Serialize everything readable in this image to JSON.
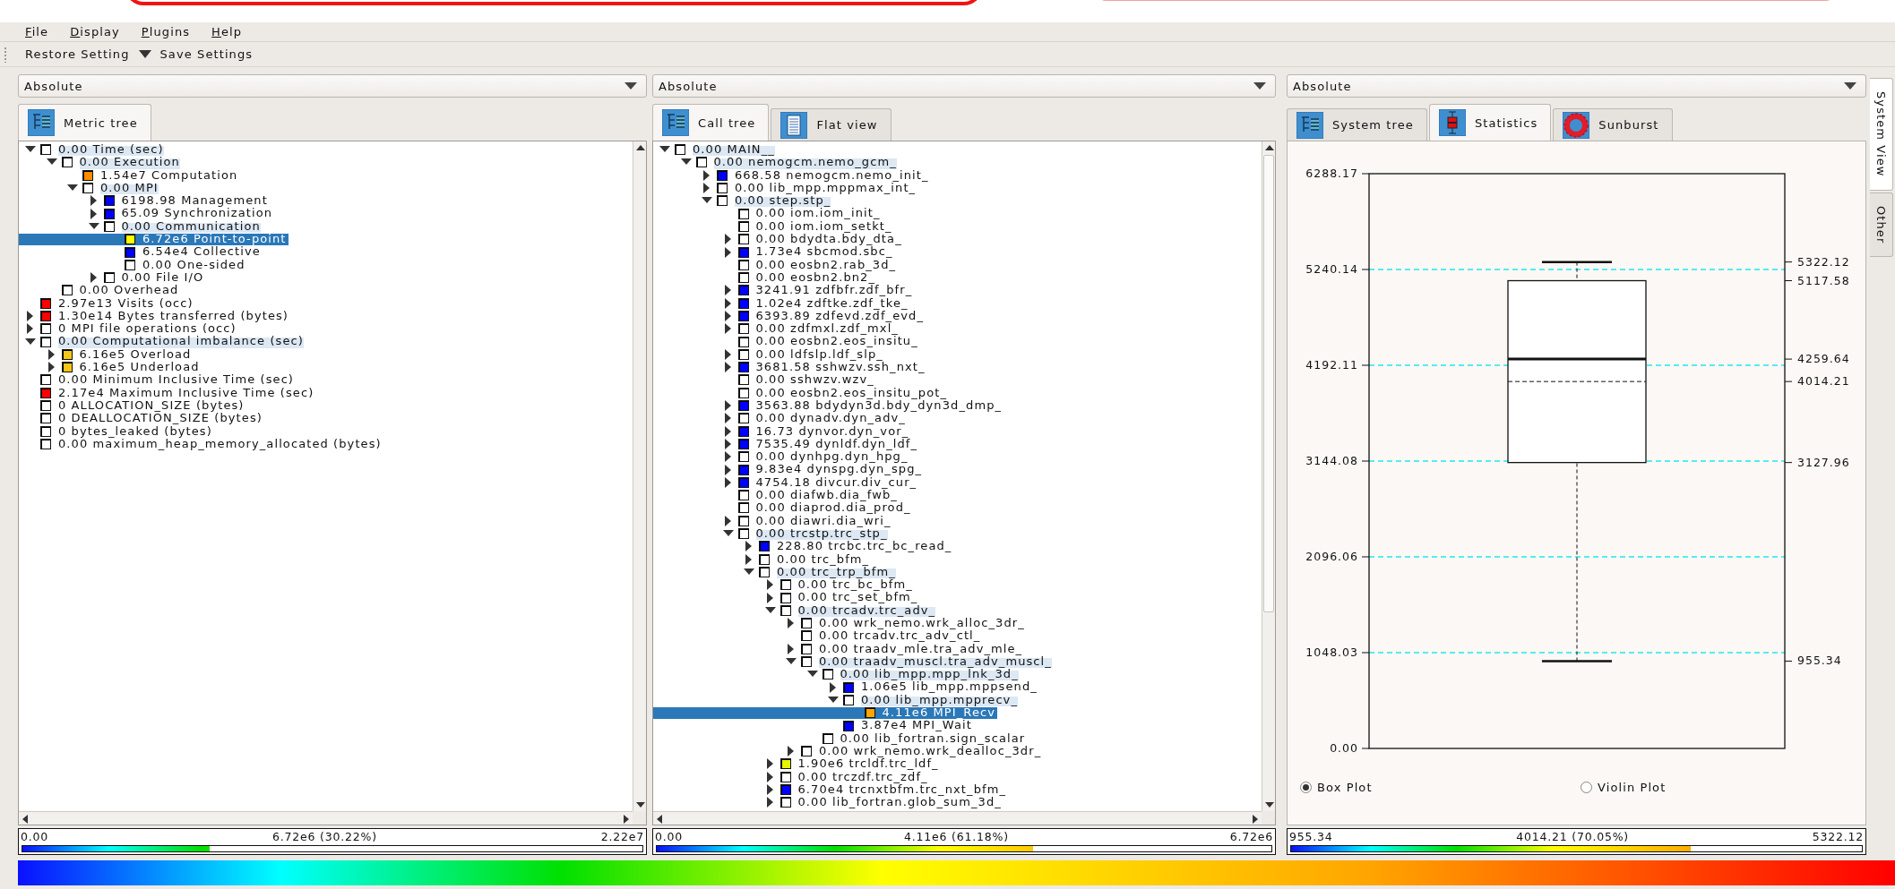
{
  "menu": [
    "File",
    "Display",
    "Plugins",
    "Help"
  ],
  "toolbar": {
    "restore": "Restore Setting",
    "save": "Save Settings"
  },
  "panels": [
    {
      "kind": "tree",
      "mode": "Absolute",
      "tabs": [
        {
          "label": "Metric tree",
          "kind": "tree",
          "selected": true
        }
      ],
      "tree": [
        {
          "text": "0.00 Time (sec)",
          "color": "#ffffff",
          "selected": false,
          "expanded": true,
          "children": [
            {
              "text": "0.00 Execution",
              "color": "#ffffff",
              "selected": false,
              "expanded": true,
              "children": [
                {
                  "text": "1.54e7 Computation",
                  "color": "#ff8c00",
                  "selected": false
                },
                {
                  "text": "0.00 MPI",
                  "color": "#ffffff",
                  "selected": false,
                  "expanded": true,
                  "children": [
                    {
                      "text": "6198.98 Management",
                      "color": "#0000ff",
                      "selected": false,
                      "expanded": false
                    },
                    {
                      "text": "65.09 Synchronization",
                      "color": "#0000ff",
                      "selected": false,
                      "expanded": false
                    },
                    {
                      "text": "0.00 Communication",
                      "color": "#ffffff",
                      "selected": false,
                      "expanded": true,
                      "children": [
                        {
                          "text": "6.72e6 Point-to-point",
                          "color": "#ffff00",
                          "selected": true
                        },
                        {
                          "text": "6.54e4 Collective",
                          "color": "#0000ff",
                          "selected": false
                        },
                        {
                          "text": "0.00 One-sided",
                          "color": "#ffffff",
                          "selected": false
                        }
                      ]
                    },
                    {
                      "text": "0.00 File I/O",
                      "color": "#ffffff",
                      "selected": false,
                      "expanded": false
                    }
                  ]
                }
              ]
            },
            {
              "text": "0.00 Overhead",
              "color": "#ffffff",
              "selected": false
            }
          ]
        },
        {
          "text": "2.97e13 Visits (occ)",
          "color": "#ff0000",
          "selected": false
        },
        {
          "text": "1.30e14 Bytes transferred (bytes)",
          "color": "#ff0000",
          "selected": false,
          "expanded": false
        },
        {
          "text": "0 MPI file operations (occ)",
          "color": "#ffffff",
          "selected": false,
          "expanded": false
        },
        {
          "text": "0.00 Computational imbalance (sec)",
          "color": "#ffffff",
          "selected": false,
          "expanded": true,
          "children": [
            {
              "text": "6.16e5 Overload",
              "color": "#f5c518",
              "selected": false,
              "expanded": false
            },
            {
              "text": "6.16e5 Underload",
              "color": "#f5c518",
              "selected": false,
              "expanded": false
            }
          ]
        },
        {
          "text": "0.00 Minimum Inclusive Time (sec)",
          "color": "#ffffff",
          "selected": false
        },
        {
          "text": "2.17e4 Maximum Inclusive Time (sec)",
          "color": "#ff0000",
          "selected": false
        },
        {
          "text": "0 ALLOCATION_SIZE (bytes)",
          "color": "#ffffff",
          "selected": false
        },
        {
          "text": "0 DEALLOCATION_SIZE (bytes)",
          "color": "#ffffff",
          "selected": false
        },
        {
          "text": "0 bytes_leaked (bytes)",
          "color": "#ffffff",
          "selected": false
        },
        {
          "text": "0.00 maximum_heap_memory_allocated (bytes)",
          "color": "#ffffff",
          "selected": false
        }
      ],
      "value_bar": {
        "min": "0.00",
        "value": "6.72e6 (30.22%)",
        "max": "2.22e7",
        "level": 0.3022
      }
    },
    {
      "kind": "tree",
      "mode": "Absolute",
      "tabs": [
        {
          "label": "Call tree",
          "kind": "tree",
          "selected": true
        },
        {
          "label": "Flat view",
          "kind": "flat",
          "selected": false
        }
      ],
      "tree": [
        {
          "text": "0.00 MAIN__",
          "color": "#ffffff",
          "selected": false,
          "expanded": true,
          "children": [
            {
              "text": "0.00 nemogcm.nemo_gcm_",
              "color": "#ffffff",
              "selected": false,
              "expanded": true,
              "children": [
                {
                  "text": "668.58 nemogcm.nemo_init_",
                  "color": "#0000ff",
                  "selected": false,
                  "expanded": false
                },
                {
                  "text": "0.00 lib_mpp.mppmax_int_",
                  "color": "#ffffff",
                  "selected": false,
                  "expanded": false
                },
                {
                  "text": "0.00 step.stp_",
                  "color": "#ffffff",
                  "selected": false,
                  "expanded": true,
                  "children": [
                    {
                      "text": "0.00 iom.iom_init_",
                      "color": "#ffffff",
                      "selected": false
                    },
                    {
                      "text": "0.00 iom.iom_setkt_",
                      "color": "#ffffff",
                      "selected": false
                    },
                    {
                      "text": "0.00 bdydta.bdy_dta_",
                      "color": "#ffffff",
                      "selected": false,
                      "expanded": false
                    },
                    {
                      "text": "1.73e4 sbcmod.sbc_",
                      "color": "#0000ff",
                      "selected": false,
                      "expanded": false
                    },
                    {
                      "text": "0.00 eosbn2.rab_3d_",
                      "color": "#ffffff",
                      "selected": false
                    },
                    {
                      "text": "0.00 eosbn2.bn2_",
                      "color": "#ffffff",
                      "selected": false
                    },
                    {
                      "text": "3241.91 zdfbfr.zdf_bfr_",
                      "color": "#0000ff",
                      "selected": false,
                      "expanded": false
                    },
                    {
                      "text": "1.02e4 zdftke.zdf_tke_",
                      "color": "#0000ff",
                      "selected": false,
                      "expanded": false
                    },
                    {
                      "text": "6393.89 zdfevd.zdf_evd_",
                      "color": "#0000ff",
                      "selected": false,
                      "expanded": false
                    },
                    {
                      "text": "0.00 zdfmxl.zdf_mxl_",
                      "color": "#ffffff",
                      "selected": false,
                      "expanded": false
                    },
                    {
                      "text": "0.00 eosbn2.eos_insitu_",
                      "color": "#ffffff",
                      "selected": false
                    },
                    {
                      "text": "0.00 ldfslp.ldf_slp_",
                      "color": "#ffffff",
                      "selected": false,
                      "expanded": false
                    },
                    {
                      "text": "3681.58 sshwzv.ssh_nxt_",
                      "color": "#0000ff",
                      "selected": false,
                      "expanded": false
                    },
                    {
                      "text": "0.00 sshwzv.wzv_",
                      "color": "#ffffff",
                      "selected": false
                    },
                    {
                      "text": "0.00 eosbn2.eos_insitu_pot_",
                      "color": "#ffffff",
                      "selected": false
                    },
                    {
                      "text": "3563.88 bdydyn3d.bdy_dyn3d_dmp_",
                      "color": "#0000ff",
                      "selected": false,
                      "expanded": false
                    },
                    {
                      "text": "0.00 dynadv.dyn_adv_",
                      "color": "#ffffff",
                      "selected": false,
                      "expanded": false
                    },
                    {
                      "text": "16.73 dynvor.dyn_vor_",
                      "color": "#0000ff",
                      "selected": false,
                      "expanded": false
                    },
                    {
                      "text": "7535.49 dynldf.dyn_ldf_",
                      "color": "#0000ff",
                      "selected": false,
                      "expanded": false
                    },
                    {
                      "text": "0.00 dynhpg.dyn_hpg_",
                      "color": "#ffffff",
                      "selected": false,
                      "expanded": false
                    },
                    {
                      "text": "9.83e4 dynspg.dyn_spg_",
                      "color": "#0000ff",
                      "selected": false,
                      "expanded": false
                    },
                    {
                      "text": "4754.18 divcur.div_cur_",
                      "color": "#0000ff",
                      "selected": false,
                      "expanded": false
                    },
                    {
                      "text": "0.00 diafwb.dia_fwb_",
                      "color": "#ffffff",
                      "selected": false
                    },
                    {
                      "text": "0.00 diaprod.dia_prod_",
                      "color": "#ffffff",
                      "selected": false
                    },
                    {
                      "text": "0.00 diawri.dia_wri_",
                      "color": "#ffffff",
                      "selected": false,
                      "expanded": false
                    },
                    {
                      "text": "0.00 trcstp.trc_stp_",
                      "color": "#ffffff",
                      "selected": false,
                      "expanded": true,
                      "children": [
                        {
                          "text": "228.80 trcbc.trc_bc_read_",
                          "color": "#0000ff",
                          "selected": false,
                          "expanded": false
                        },
                        {
                          "text": "0.00 trc_bfm_",
                          "color": "#ffffff",
                          "selected": false,
                          "expanded": false
                        },
                        {
                          "text": "0.00 trc_trp_bfm_",
                          "color": "#ffffff",
                          "selected": false,
                          "expanded": true,
                          "children": [
                            {
                              "text": "0.00 trc_bc_bfm_",
                              "color": "#ffffff",
                              "selected": false,
                              "expanded": false
                            },
                            {
                              "text": "0.00 trc_set_bfm_",
                              "color": "#ffffff",
                              "selected": false,
                              "expanded": false
                            },
                            {
                              "text": "0.00 trcadv.trc_adv_",
                              "color": "#ffffff",
                              "selected": false,
                              "expanded": true,
                              "children": [
                                {
                                  "text": "0.00 wrk_nemo.wrk_alloc_3dr_",
                                  "color": "#ffffff",
                                  "selected": false,
                                  "expanded": false
                                },
                                {
                                  "text": "0.00 trcadv.trc_adv_ctl_",
                                  "color": "#ffffff",
                                  "selected": false
                                },
                                {
                                  "text": "0.00 traadv_mle.tra_adv_mle_",
                                  "color": "#ffffff",
                                  "selected": false,
                                  "expanded": false
                                },
                                {
                                  "text": "0.00 traadv_muscl.tra_adv_muscl_",
                                  "color": "#ffffff",
                                  "selected": false,
                                  "expanded": true,
                                  "children": [
                                    {
                                      "text": "0.00 lib_mpp.mpp_lnk_3d_",
                                      "color": "#ffffff",
                                      "selected": false,
                                      "expanded": true,
                                      "children": [
                                        {
                                          "text": "1.06e5 lib_mpp.mppsend_",
                                          "color": "#0000ff",
                                          "selected": false,
                                          "expanded": false
                                        },
                                        {
                                          "text": "0.00 lib_mpp.mpprecv_",
                                          "color": "#ffffff",
                                          "selected": false,
                                          "expanded": true,
                                          "children": [
                                            {
                                              "text": "4.11e6 MPI_Recv",
                                              "color": "#ffa500",
                                              "selected": true
                                            }
                                          ]
                                        },
                                        {
                                          "text": "3.87e4 MPI_Wait",
                                          "color": "#0000ff",
                                          "selected": false
                                        }
                                      ]
                                    },
                                    {
                                      "text": "0.00 lib_fortran.sign_scalar",
                                      "color": "#ffffff",
                                      "selected": false
                                    }
                                  ]
                                },
                                {
                                  "text": "0.00 wrk_nemo.wrk_dealloc_3dr_",
                                  "color": "#ffffff",
                                  "selected": false,
                                  "expanded": false
                                }
                              ]
                            },
                            {
                              "text": "1.90e6 trcldf.trc_ldf_",
                              "color": "#e6f500",
                              "selected": false,
                              "expanded": false
                            },
                            {
                              "text": "0.00 trczdf.trc_zdf_",
                              "color": "#ffffff",
                              "selected": false,
                              "expanded": false
                            },
                            {
                              "text": "6.70e4 trcnxtbfm.trc_nxt_bfm_",
                              "color": "#0000ff",
                              "selected": false,
                              "expanded": false
                            },
                            {
                              "text": "0.00 lib_fortran.glob_sum_3d_",
                              "color": "#ffffff",
                              "selected": false,
                              "expanded": false
                            }
                          ]
                        }
                      ]
                    }
                  ]
                }
              ]
            }
          ]
        }
      ],
      "value_bar": {
        "min": "0.00",
        "value": "4.11e6 (61.18%)",
        "max": "6.72e6",
        "level": 0.6118
      }
    },
    {
      "kind": "boxplot",
      "mode": "Absolute",
      "tabs": [
        {
          "label": "System tree",
          "kind": "tree",
          "selected": false
        },
        {
          "label": "Statistics",
          "kind": "statistics",
          "selected": true
        },
        {
          "label": "Sunburst",
          "kind": "sunburst",
          "selected": false
        }
      ],
      "plot": {
        "y_ticks": [
          "6288.17",
          "5240.14",
          "4192.11",
          "3144.08",
          "2096.06",
          "1048.03",
          "0.00"
        ],
        "stats": [
          {
            "kind": "max",
            "label": "5322.12"
          },
          {
            "kind": "q3",
            "label": "5117.58"
          },
          {
            "kind": "median",
            "label": "4259.64"
          },
          {
            "kind": "mean",
            "label": "4014.21"
          },
          {
            "kind": "q1",
            "label": "3127.96"
          },
          {
            "kind": "min",
            "label": "955.34"
          }
        ]
      },
      "plot_types": [
        {
          "label": "Box Plot",
          "selected": true
        },
        {
          "label": "Violin Plot",
          "selected": false
        }
      ],
      "value_bar": {
        "min": "955.34",
        "value": "4014.21 (70.05%)",
        "max": "5322.12",
        "level": 0.7005
      }
    }
  ],
  "side_tabs": [
    {
      "label": "System View",
      "selected": true
    },
    {
      "label": "Other",
      "selected": false
    }
  ]
}
